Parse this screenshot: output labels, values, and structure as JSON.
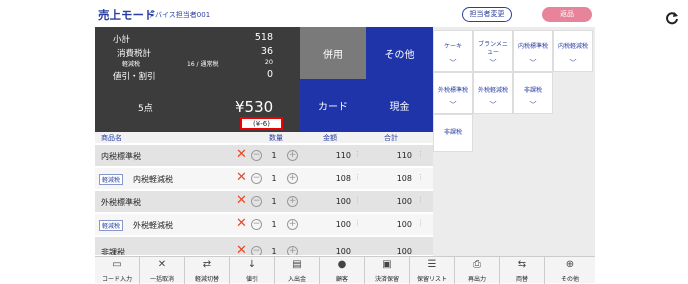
{
  "header": {
    "title": "売上モード",
    "staff": "デバイス担当者001",
    "change_staff": "担当者変更",
    "returns": "返品"
  },
  "summary": {
    "subtotal_label": "小計",
    "subtotal": "518",
    "tax_label": "消費税計",
    "tax": "36",
    "reduced_label": "軽減税",
    "reduced_mid": "16 / 通常税",
    "reduced_val": "20",
    "discount_label": "値引・割引",
    "discount_val": "0",
    "qty": "5点",
    "total": "¥530",
    "discount_note": "(¥-6)"
  },
  "payments": {
    "combined": "併用",
    "other": "その他",
    "card": "カード",
    "cash": "現金"
  },
  "categories": [
    {
      "label": "ケーキ"
    },
    {
      "label": "ブランメニュー"
    },
    {
      "label": "内税標準税"
    },
    {
      "label": "内税軽減税"
    },
    {
      "label": "外税標準税"
    },
    {
      "label": "外税軽減税"
    },
    {
      "label": "非課税"
    },
    {
      "label": "非課税"
    }
  ],
  "table": {
    "headers": {
      "name": "商品名",
      "qty": "数量",
      "price": "金額",
      "total": "合計"
    },
    "rows": [
      {
        "tag": "",
        "name": "内税標準税",
        "qty": "1",
        "price": "110",
        "total": "110"
      },
      {
        "tag": "軽減税",
        "name": "内税軽減税",
        "qty": "1",
        "price": "108",
        "total": "108"
      },
      {
        "tag": "",
        "name": "外税標準税",
        "qty": "1",
        "price": "100",
        "total": "100"
      },
      {
        "tag": "軽減税",
        "name": "外税軽減税",
        "qty": "1",
        "price": "100",
        "total": "100"
      },
      {
        "tag": "",
        "name": "非課税",
        "qty": "1",
        "price": "100",
        "total": "100"
      }
    ]
  },
  "toolbar": [
    {
      "label": "コード入力",
      "icon": "barcode-icon"
    },
    {
      "label": "一括取消",
      "icon": "x-icon"
    },
    {
      "label": "軽減切替",
      "icon": "switch-icon"
    },
    {
      "label": "値引",
      "icon": "discount-icon"
    },
    {
      "label": "入出金",
      "icon": "cashbox-icon"
    },
    {
      "label": "顧客",
      "icon": "person-icon"
    },
    {
      "label": "決済保留",
      "icon": "hold-icon"
    },
    {
      "label": "保留リスト",
      "icon": "list-icon"
    },
    {
      "label": "再出力",
      "icon": "printer-icon"
    },
    {
      "label": "両替",
      "icon": "exchange-icon"
    },
    {
      "label": "その他",
      "icon": "plus-icon"
    }
  ]
}
